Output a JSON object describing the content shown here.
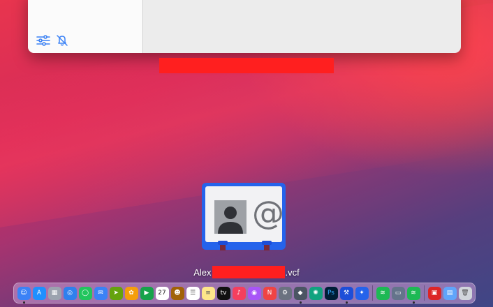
{
  "filename": {
    "prefix": "Alex",
    "suffix": ".vcf"
  },
  "window": {
    "icons": [
      "sliders-icon",
      "bell-slash-icon"
    ]
  },
  "dock": {
    "items": [
      {
        "name": "finder",
        "glyph": "☺",
        "bg": "#3b82f6",
        "running": true
      },
      {
        "name": "app-store",
        "glyph": "A",
        "bg": "#1e90ff",
        "running": false
      },
      {
        "name": "launchpad",
        "glyph": "▦",
        "bg": "#9ca3af",
        "running": false
      },
      {
        "name": "safari",
        "glyph": "◎",
        "bg": "#2f80ed",
        "running": false
      },
      {
        "name": "messages",
        "glyph": "◯",
        "bg": "#22c55e",
        "running": false
      },
      {
        "name": "mail",
        "glyph": "✉",
        "bg": "#3b82f6",
        "running": false
      },
      {
        "name": "maps",
        "glyph": "➤",
        "bg": "#65a30d",
        "running": false
      },
      {
        "name": "photos",
        "glyph": "✿",
        "bg": "#f59e0b",
        "running": false
      },
      {
        "name": "facetime",
        "glyph": "▶",
        "bg": "#16a34a",
        "running": false
      },
      {
        "name": "calendar",
        "glyph": "27",
        "bg": "#ffffff",
        "fg": "#222",
        "running": false
      },
      {
        "name": "contacts",
        "glyph": "☻",
        "bg": "#a16207",
        "running": false
      },
      {
        "name": "reminders",
        "glyph": "☰",
        "bg": "#ffffff",
        "fg": "#555",
        "running": false
      },
      {
        "name": "notes",
        "glyph": "≡",
        "bg": "#fde68a",
        "fg": "#555",
        "running": false
      },
      {
        "name": "apple-tv",
        "glyph": "tv",
        "bg": "#111111",
        "running": false
      },
      {
        "name": "music",
        "glyph": "♪",
        "bg": "#f43f5e",
        "running": false
      },
      {
        "name": "podcasts",
        "glyph": "◉",
        "bg": "#a855f7",
        "running": false
      },
      {
        "name": "news",
        "glyph": "N",
        "bg": "#ef4444",
        "running": false
      },
      {
        "name": "system-preferences",
        "glyph": "⚙",
        "bg": "#6b7280",
        "running": false
      },
      {
        "name": "vpn",
        "glyph": "◆",
        "bg": "#4b5563",
        "running": true
      },
      {
        "name": "chatgpt",
        "glyph": "✺",
        "bg": "#10a37f",
        "running": false
      },
      {
        "name": "photoshop",
        "glyph": "Ps",
        "bg": "#001e36",
        "fg": "#31a8ff",
        "running": false
      },
      {
        "name": "xcode",
        "glyph": "⚒",
        "bg": "#1d4ed8",
        "running": true
      },
      {
        "name": "simulator",
        "glyph": "✦",
        "bg": "#2563eb",
        "running": false
      },
      {
        "sep": true
      },
      {
        "name": "spotify-a",
        "glyph": "≋",
        "bg": "#1db954",
        "running": false
      },
      {
        "name": "preview",
        "glyph": "▭",
        "bg": "#64748b",
        "running": false
      },
      {
        "name": "spotify-b",
        "glyph": "≋",
        "bg": "#1db954",
        "running": true
      },
      {
        "sep": true
      },
      {
        "name": "downloads",
        "glyph": "▣",
        "bg": "#dc2626",
        "running": false
      },
      {
        "name": "folder",
        "glyph": "▤",
        "bg": "#60a5fa",
        "running": false
      },
      {
        "name": "trash",
        "glyph": "🗑",
        "bg": "#d1d5db",
        "fg": "#555",
        "running": false
      }
    ]
  }
}
